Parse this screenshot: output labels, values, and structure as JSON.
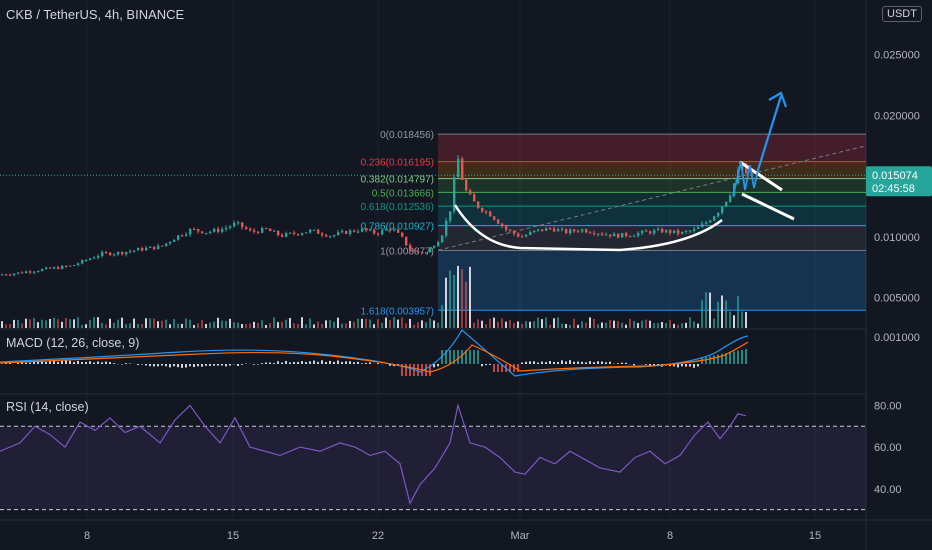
{
  "header": {
    "title": "CKB / TetherUS, 4h, BINANCE",
    "currency": "USDT"
  },
  "macd": {
    "label": "MACD (12, 26, close, 9)"
  },
  "rsi": {
    "label": "RSI (14, close)"
  },
  "chart_data": {
    "type": "candlestick",
    "symbol": "CKB / TetherUS",
    "interval": "4h",
    "exchange": "BINANCE",
    "price_axis": {
      "ticks": [
        "0.025000",
        "0.020000",
        "0.010000",
        "0.005000",
        "0.001000"
      ],
      "range": [
        0.0025,
        0.0295
      ]
    },
    "time_axis": {
      "ticks": [
        "8",
        "15",
        "22",
        "Mar",
        "8",
        "15"
      ]
    },
    "last_price": {
      "value": "0.015074",
      "countdown": "02:45:58"
    },
    "price_path": [
      [
        0,
        0.0069
      ],
      [
        14,
        0.007
      ],
      [
        30,
        0.0072
      ],
      [
        50,
        0.0074
      ],
      [
        70,
        0.0076
      ],
      [
        85,
        0.0081
      ],
      [
        100,
        0.0086
      ],
      [
        120,
        0.0087
      ],
      [
        140,
        0.009
      ],
      [
        160,
        0.0092
      ],
      [
        175,
        0.01
      ],
      [
        190,
        0.0106
      ],
      [
        205,
        0.0104
      ],
      [
        220,
        0.0106
      ],
      [
        235,
        0.0111
      ],
      [
        250,
        0.0104
      ],
      [
        265,
        0.0106
      ],
      [
        280,
        0.0101
      ],
      [
        295,
        0.0103
      ],
      [
        310,
        0.0105
      ],
      [
        330,
        0.0101
      ],
      [
        345,
        0.0104
      ],
      [
        360,
        0.0106
      ],
      [
        375,
        0.0103
      ],
      [
        390,
        0.0107
      ],
      [
        400,
        0.01
      ],
      [
        410,
        0.0088
      ],
      [
        425,
        0.0087
      ],
      [
        440,
        0.01
      ],
      [
        450,
        0.0125
      ],
      [
        456,
        0.0168
      ],
      [
        463,
        0.014
      ],
      [
        475,
        0.0126
      ],
      [
        490,
        0.0118
      ],
      [
        505,
        0.0106
      ],
      [
        520,
        0.01
      ],
      [
        535,
        0.0105
      ],
      [
        550,
        0.0107
      ],
      [
        565,
        0.0104
      ],
      [
        580,
        0.0106
      ],
      [
        600,
        0.0103
      ],
      [
        615,
        0.0101
      ],
      [
        630,
        0.0102
      ],
      [
        645,
        0.0104
      ],
      [
        660,
        0.0105
      ],
      [
        680,
        0.0103
      ],
      [
        695,
        0.0106
      ],
      [
        708,
        0.0114
      ],
      [
        718,
        0.0122
      ],
      [
        728,
        0.0134
      ],
      [
        736,
        0.015
      ],
      [
        740,
        0.0163
      ],
      [
        744,
        0.015
      ],
      [
        748,
        0.0151
      ]
    ],
    "fibonacci": [
      {
        "level": "0(0.018456)",
        "price": 0.018456
      },
      {
        "level": "0.236(0.016195)",
        "price": 0.016195
      },
      {
        "level": "0.382(0.014797)",
        "price": 0.014797
      },
      {
        "level": "0.5(0.013666)",
        "price": 0.013666
      },
      {
        "level": "0.618(0.012536)",
        "price": 0.012536
      },
      {
        "level": "0.786(0.010927)",
        "price": 0.010927
      },
      {
        "level": "1(0.008877)",
        "price": 0.008877
      },
      {
        "level": "1.618(0.003957)",
        "price": 0.003957
      }
    ],
    "macd_axis": {
      "ticks": [
        "0.001000"
      ]
    },
    "rsi_axis": {
      "ticks": [
        "80.00",
        "60.00",
        "40.00"
      ],
      "bands": [
        70,
        30
      ],
      "range": [
        25,
        85
      ]
    },
    "rsi_path": [
      [
        0,
        58
      ],
      [
        20,
        62
      ],
      [
        35,
        70
      ],
      [
        50,
        66
      ],
      [
        65,
        60
      ],
      [
        80,
        72
      ],
      [
        95,
        68
      ],
      [
        110,
        74
      ],
      [
        125,
        67
      ],
      [
        140,
        70
      ],
      [
        160,
        62
      ],
      [
        175,
        73
      ],
      [
        190,
        80
      ],
      [
        205,
        70
      ],
      [
        220,
        62
      ],
      [
        235,
        74
      ],
      [
        250,
        60
      ],
      [
        265,
        58
      ],
      [
        280,
        56
      ],
      [
        300,
        60
      ],
      [
        320,
        58
      ],
      [
        340,
        62
      ],
      [
        355,
        60
      ],
      [
        370,
        56
      ],
      [
        385,
        58
      ],
      [
        400,
        52
      ],
      [
        410,
        33
      ],
      [
        420,
        42
      ],
      [
        435,
        50
      ],
      [
        450,
        62
      ],
      [
        458,
        80
      ],
      [
        470,
        62
      ],
      [
        485,
        60
      ],
      [
        500,
        55
      ],
      [
        515,
        48
      ],
      [
        525,
        47
      ],
      [
        540,
        55
      ],
      [
        555,
        52
      ],
      [
        570,
        58
      ],
      [
        585,
        54
      ],
      [
        600,
        50
      ],
      [
        620,
        48
      ],
      [
        635,
        55
      ],
      [
        650,
        58
      ],
      [
        665,
        52
      ],
      [
        680,
        56
      ],
      [
        695,
        66
      ],
      [
        708,
        72
      ],
      [
        720,
        64
      ],
      [
        730,
        70
      ],
      [
        738,
        76
      ],
      [
        746,
        75
      ]
    ],
    "colors": {
      "up": "#26a69a",
      "down": "#ef5350",
      "background": "#131722",
      "grid": "#1e222d",
      "pattern": "#ffffff",
      "arrow": "#2196f3",
      "rsi": "#7e57c2",
      "macd": "#2196f3",
      "signal": "#ff6d00"
    }
  }
}
